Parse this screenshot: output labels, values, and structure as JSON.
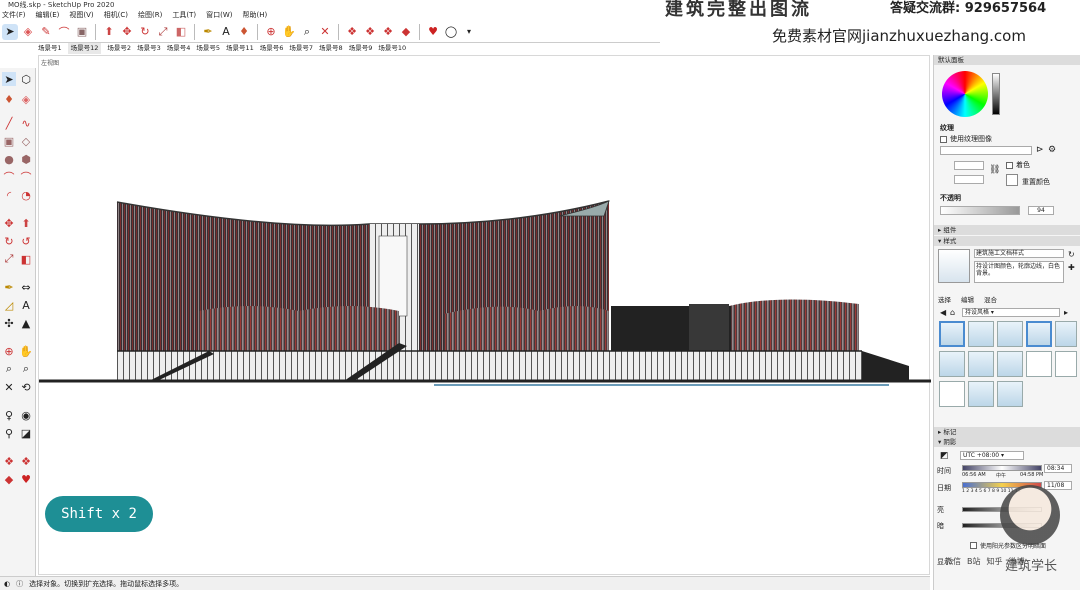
{
  "window": {
    "title": "MO线.skp - SketchUp Pro 2020"
  },
  "menu": [
    "文件(F)",
    "编辑(E)",
    "视图(V)",
    "相机(C)",
    "绘图(R)",
    "工具(T)",
    "窗口(W)",
    "帮助(H)"
  ],
  "scenes": [
    "场景号1",
    "场景号12",
    "场景号2",
    "场景号3",
    "场景号4",
    "场景号5",
    "场景号11",
    "场景号6",
    "场景号7",
    "场景号8",
    "场景号9",
    "场景号10"
  ],
  "active_scene": "场景号12",
  "viewport": {
    "label": "左视图"
  },
  "status": {
    "text": "选择对象。切换到扩充选择。拖动鼠标选择多项。"
  },
  "watermark": {
    "title": "建筑完整出图流",
    "qq": "答疑交流群: 929657564",
    "site": "免费素材官网jianzhuxuezhang.com",
    "brand": "建筑学长",
    "corner": [
      "微信",
      "B站",
      "知乎",
      "微博"
    ]
  },
  "shift_badge": "Shift x 2",
  "right_panel": {
    "default_tray": "默认面板",
    "texture_title": "纹理",
    "use_texture": "使用纹理图像",
    "colorize": "着色",
    "reset_color": "重置颜色",
    "opacity_title": "不透明",
    "opacity_value": "94",
    "components": "组件",
    "styles": "样式",
    "style_name": "建筑施工文档样式",
    "style_desc": "持设计图颜色，轮廓边线，白色背景。",
    "style_tabs": [
      "选择",
      "编辑",
      "混合"
    ],
    "style_dropdown": "持设风格",
    "tags": "标记",
    "shadows": "阴影",
    "utc": "UTC +08:00",
    "time_label": "时间",
    "date_label": "日期",
    "time_value": "08:34",
    "date_value": "11/08",
    "time_start": "06:56 AM",
    "time_mid": "中午",
    "time_end": "04:58 PM",
    "date_ticks": "1 2 3 4 5 6 7 8 9 10 11 12",
    "light_label": "亮",
    "dark_label": "暗",
    "use_sun": "使用阳光参数区分明暗面",
    "display_label": "显示:"
  }
}
